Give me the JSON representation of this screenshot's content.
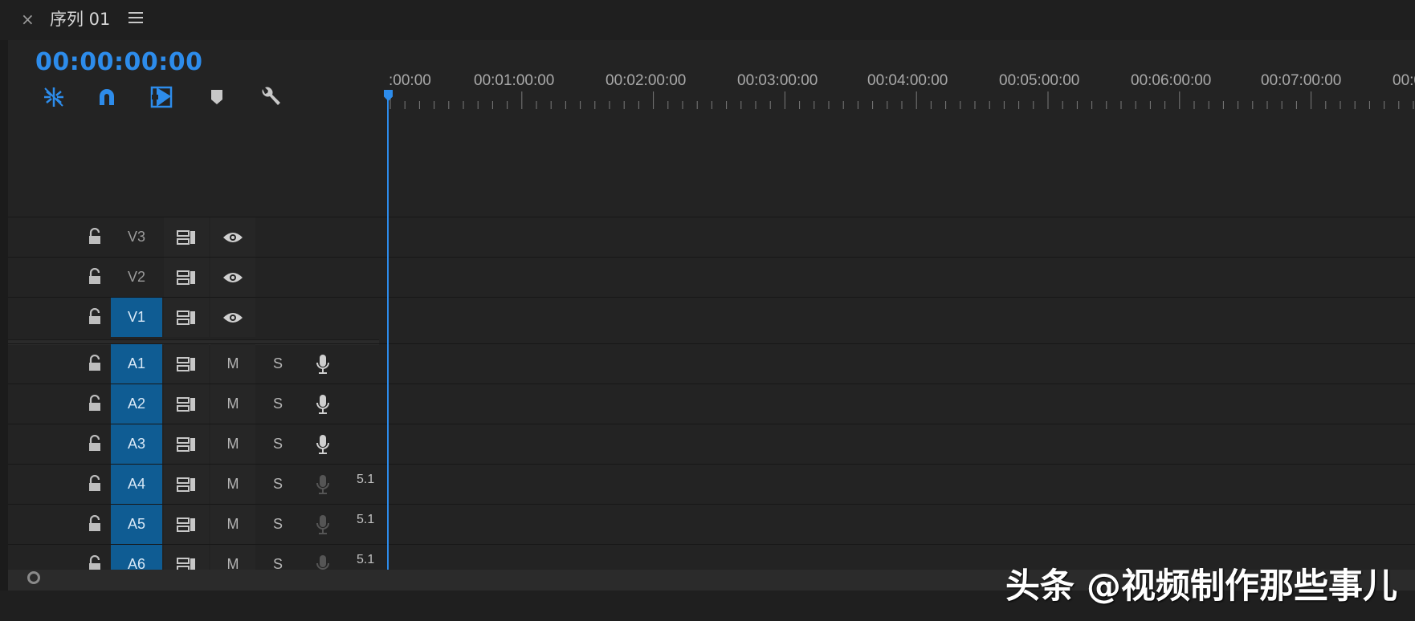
{
  "tab": {
    "title": "序列 01"
  },
  "timecode": "00:00:00:00",
  "toolbar": {
    "items": [
      {
        "name": "insert-overwrite-icon"
      },
      {
        "name": "snap-icon"
      },
      {
        "name": "linked-selection-icon"
      },
      {
        "name": "add-marker-icon"
      },
      {
        "name": "settings-wrench-icon"
      }
    ]
  },
  "ruler": {
    "labels": [
      ":00:00",
      "00:01:00:00",
      "00:02:00:00",
      "00:03:00:00",
      "00:04:00:00",
      "00:05:00:00",
      "00:06:00:00",
      "00:07:00:00",
      "00:0"
    ]
  },
  "video_tracks": [
    {
      "name": "V3",
      "targeted": false
    },
    {
      "name": "V2",
      "targeted": false
    },
    {
      "name": "V1",
      "targeted": true
    }
  ],
  "audio_tracks": [
    {
      "name": "A1",
      "mute": "M",
      "solo": "S",
      "channel": ""
    },
    {
      "name": "A2",
      "mute": "M",
      "solo": "S",
      "channel": ""
    },
    {
      "name": "A3",
      "mute": "M",
      "solo": "S",
      "channel": ""
    },
    {
      "name": "A4",
      "mute": "M",
      "solo": "S",
      "channel": "5.1"
    },
    {
      "name": "A5",
      "mute": "M",
      "solo": "S",
      "channel": "5.1"
    },
    {
      "name": "A6",
      "mute": "M",
      "solo": "S",
      "channel": "5.1"
    }
  ],
  "watermark": "头条 @视频制作那些事儿",
  "colors": {
    "accent": "#2d8ceb",
    "target": "#0f5c93",
    "background": "#232323"
  }
}
